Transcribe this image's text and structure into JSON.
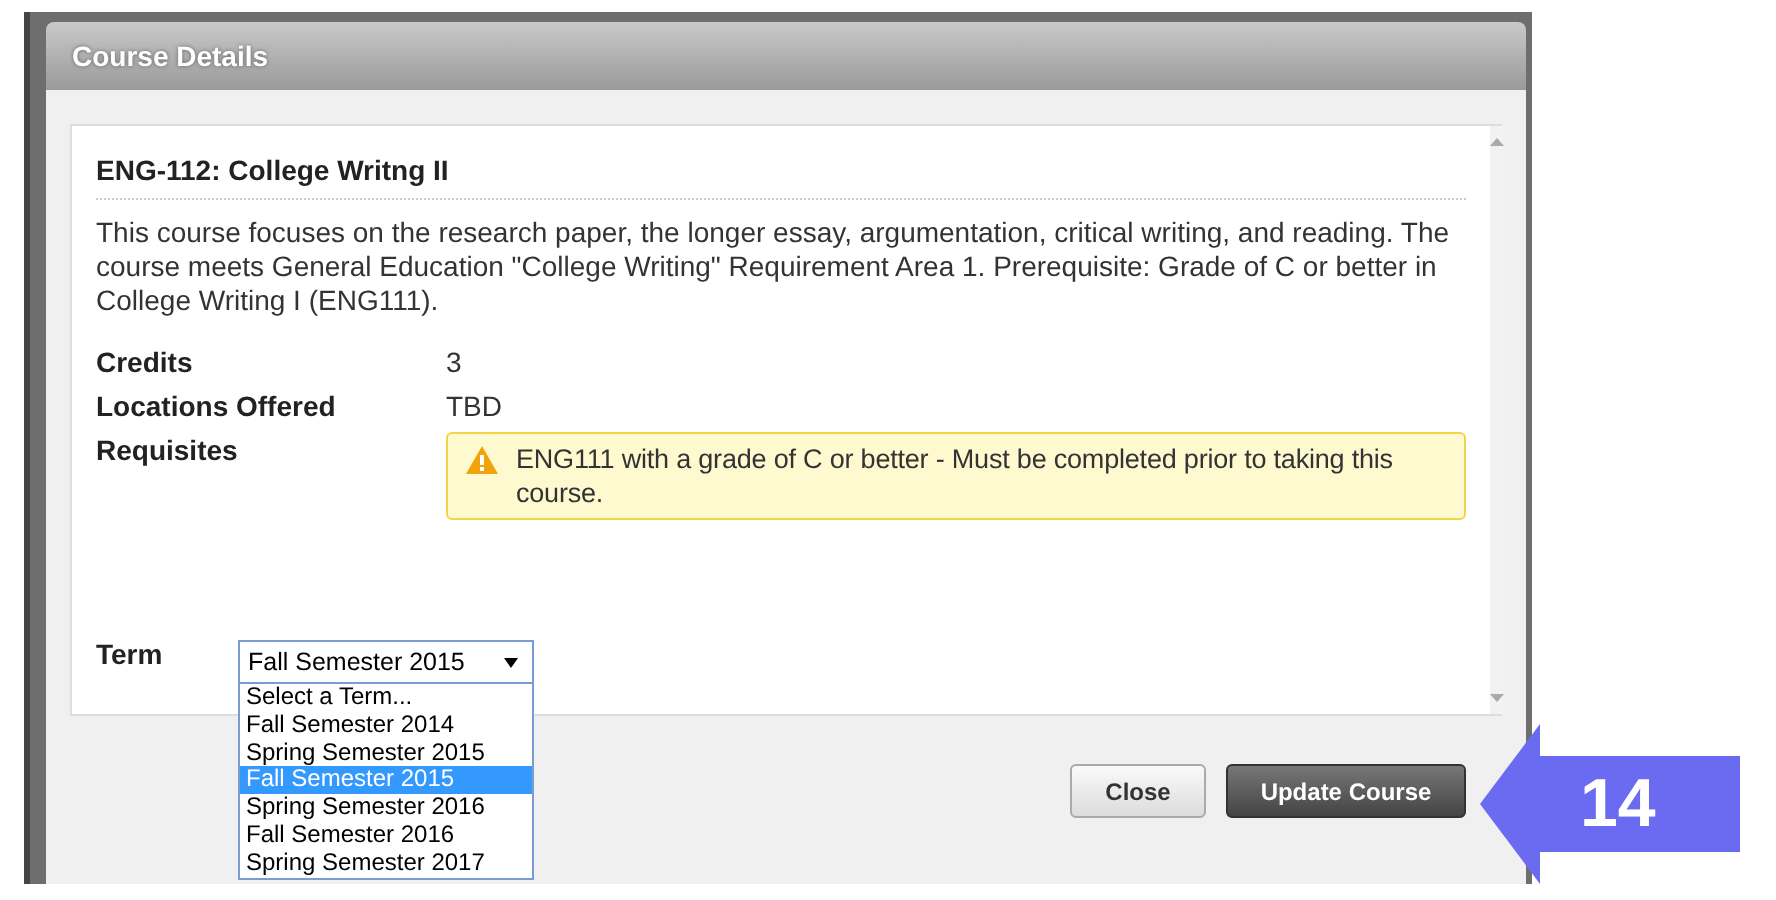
{
  "dialog": {
    "title": "Course Details"
  },
  "course": {
    "heading": "ENG-112: College Writng II",
    "description": "This course focuses on the research paper, the longer essay, argumentation, critical writing, and reading. The course meets General Education \"College Writing\" Requirement Area 1. Prerequisite: Grade of C or better in College Writing I (ENG111).",
    "details": [
      {
        "label": "Credits",
        "value": "3",
        "kind": "text"
      },
      {
        "label": "Locations Offered",
        "value": "TBD",
        "kind": "text"
      },
      {
        "label": "Requisites",
        "value": "ENG111 with a grade of C or better - Must be completed prior to taking this course.",
        "kind": "warning"
      }
    ]
  },
  "term": {
    "label": "Term",
    "value": "Fall Semester 2015",
    "expanded": true,
    "options": [
      {
        "label": "Select a Term...",
        "selected": false
      },
      {
        "label": "Fall Semester 2014",
        "selected": false
      },
      {
        "label": "Spring Semester 2015",
        "selected": false
      },
      {
        "label": "Fall Semester 2015",
        "selected": true
      },
      {
        "label": "Spring Semester 2016",
        "selected": false
      },
      {
        "label": "Fall Semester 2016",
        "selected": false
      },
      {
        "label": "Spring Semester 2017",
        "selected": false
      }
    ]
  },
  "buttons": [
    {
      "label": "Close",
      "kind": "secondary"
    },
    {
      "label": "Update Course",
      "kind": "primary"
    }
  ],
  "annotation": {
    "number": "14"
  }
}
